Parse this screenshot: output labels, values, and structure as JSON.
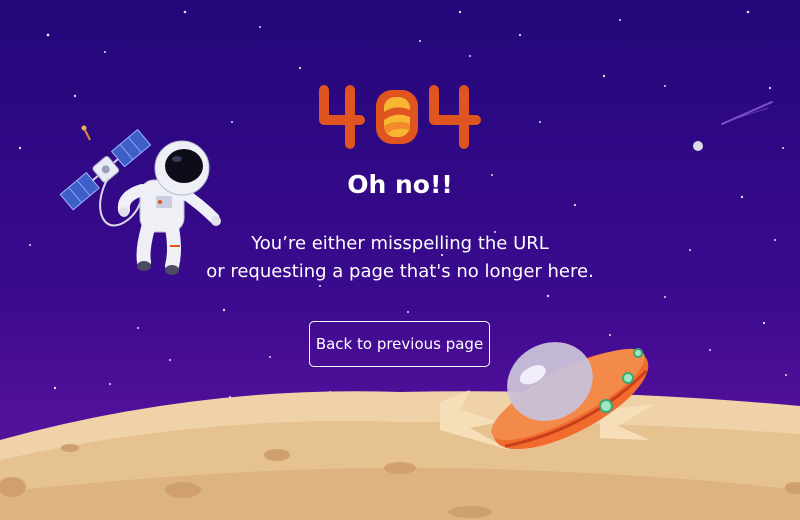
{
  "page": {
    "error_code": "404",
    "title": "Oh no!!",
    "message_line1": "You’re either misspelling the URL",
    "message_line2": "or requesting a page that's no longer here.",
    "back_button_label": "Back to previous page"
  },
  "colors": {
    "background_top": "#23077a",
    "background_bottom": "#5a1296",
    "logo_orange": "#e0541f",
    "logo_yellow": "#f7b733",
    "moon_surface": "#efd2a8",
    "ufo_body": "#f26a2e"
  },
  "icons": {
    "satellite": "satellite-icon",
    "astronaut": "astronaut-icon",
    "ufo": "crashed-ufo-icon",
    "moon": "moon-surface-icon",
    "planet": "planet-icon",
    "meteor": "meteor-icon"
  }
}
